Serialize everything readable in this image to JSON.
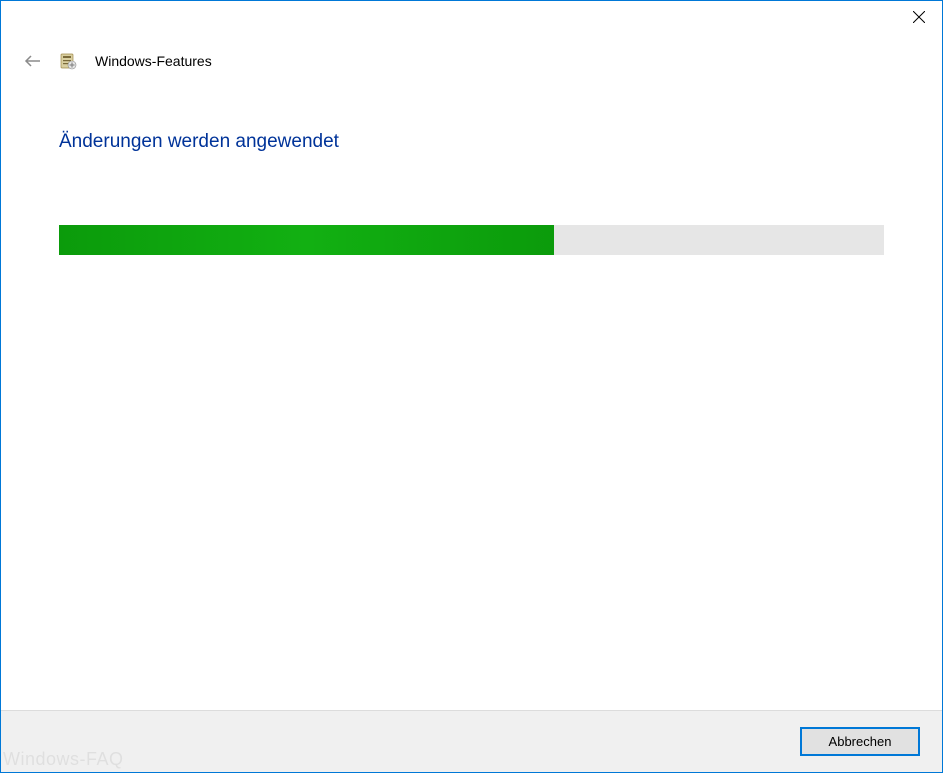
{
  "header": {
    "title": "Windows-Features"
  },
  "main": {
    "heading": "Änderungen werden angewendet",
    "progress_percent": 60
  },
  "footer": {
    "cancel_label": "Abbrechen"
  },
  "watermark": "Windows-FAQ"
}
